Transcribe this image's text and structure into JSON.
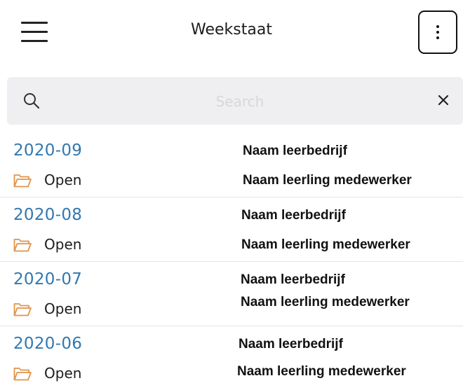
{
  "header": {
    "title": "Weekstaat",
    "menu_icon": "hamburger-menu-icon",
    "more_icon": "vertical-dots-icon"
  },
  "search": {
    "placeholder": "Search",
    "value": "",
    "search_icon": "magnifier-icon",
    "clear_icon": "close-x-icon"
  },
  "colors": {
    "period": "#3178b0",
    "folder": "#e0944a",
    "search_bg": "#efeff1"
  },
  "timesheets": [
    {
      "period": "2020-09",
      "status": "Open",
      "company": "Naam leerbedrijf",
      "student": "Naam leerling medewerker",
      "status_icon": "folder-open-icon"
    },
    {
      "period": "2020-08",
      "status": "Open",
      "company": "Naam leerbedrijf",
      "student": "Naam leerling medewerker",
      "status_icon": "folder-open-icon"
    },
    {
      "period": "2020-07",
      "status": "Open",
      "company": "Naam leerbedrijf",
      "student": "Naam leerling medewerker",
      "status_icon": "folder-open-icon"
    },
    {
      "period": "2020-06",
      "status": "Open",
      "company": "Naam leerbedrijf",
      "student": "Naam leerling medewerker",
      "status_icon": "folder-open-icon"
    }
  ]
}
